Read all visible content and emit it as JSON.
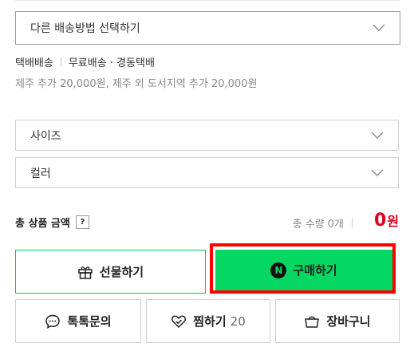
{
  "delivery": {
    "select_label": "다른 배송방법 선택하기",
    "method": "택배배송",
    "fee": "무료배송 · 경동택배",
    "extra": "제주 추가 20,000원, 제주 외 도서지역 추가 20,000원"
  },
  "options": {
    "size_label": "사이즈",
    "color_label": "컬러"
  },
  "total": {
    "label": "총 상품 금액",
    "help": "?",
    "quantity": "총 수량 0개",
    "price_value": "0",
    "price_unit": "원"
  },
  "buttons": {
    "gift": "선물하기",
    "buy": "구매하기",
    "buy_badge": "N",
    "inquiry": "톡톡문의",
    "wish": "찜하기",
    "wish_count": "20",
    "cart": "장바구니"
  },
  "colors": {
    "naver_green": "#06d662",
    "price_red": "#e0001b",
    "highlight_red": "#ff0000"
  }
}
